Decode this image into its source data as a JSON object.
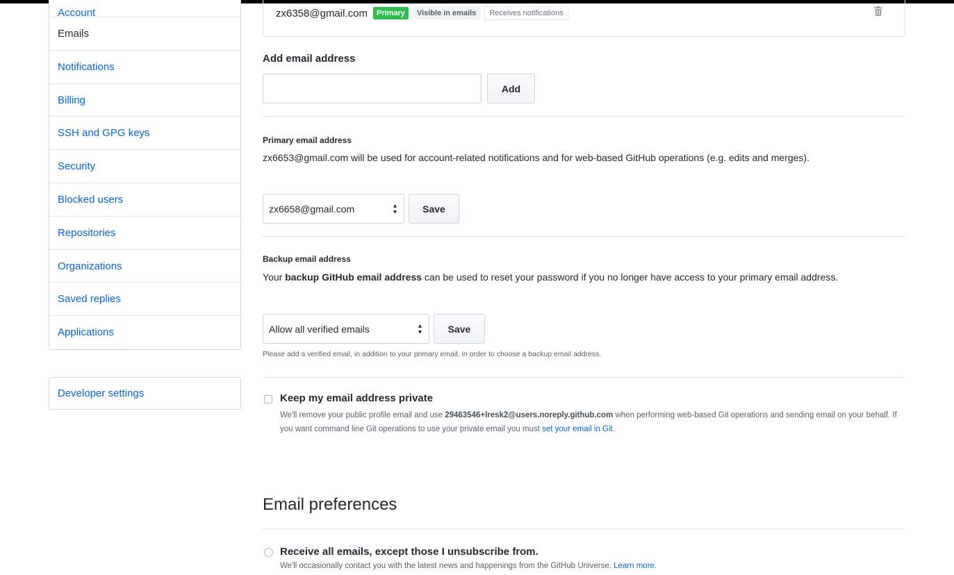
{
  "sidebar": {
    "items": [
      {
        "label": "Account"
      },
      {
        "label": "Emails"
      },
      {
        "label": "Notifications"
      },
      {
        "label": "Billing"
      },
      {
        "label": "SSH and GPG keys"
      },
      {
        "label": "Security"
      },
      {
        "label": "Blocked users"
      },
      {
        "label": "Repositories"
      },
      {
        "label": "Organizations"
      },
      {
        "label": "Saved replies"
      },
      {
        "label": "Applications"
      }
    ],
    "developer_settings": "Developer settings"
  },
  "email_entry": {
    "address": "zx6358@gmail.com",
    "badge_primary": "Primary",
    "badge_visible": "Visible in emails",
    "badge_notifications": "Receives notifications",
    "trash_icon": "trash-icon"
  },
  "add_email": {
    "heading": "Add email address",
    "input_value": "",
    "button": "Add"
  },
  "primary_email": {
    "heading": "Primary email address",
    "description": "zx6653@gmail.com will be used for account-related notifications and for web-based GitHub operations (e.g. edits and merges).",
    "select_value": "zx6658@gmail.com",
    "button": "Save"
  },
  "backup_email": {
    "heading": "Backup email address",
    "desc_prefix": "Your ",
    "desc_strong": "backup GitHub email address",
    "desc_suffix": " can be used to reset your password if you no longer have access to your primary email address.",
    "select_value": "Allow all verified emails",
    "button": "Save",
    "note": "Please add a verified email, in addition to your primary email, in order to choose a backup email address."
  },
  "keep_private": {
    "label": "Keep my email address private",
    "desc_prefix": "We'll remove your public profile email and use ",
    "noreply": "29463546+lresk2@users.noreply.github.com",
    "desc_middle": " when performing web-based Git operations and sending email on your behalf. If you want command line Git operations to use your private email you must ",
    "link": "set your email in Git",
    "desc_suffix": "."
  },
  "email_preferences": {
    "heading": "Email preferences",
    "option_label": "Receive all emails, except those I unsubscribe from.",
    "option_desc": "We'll occasionally contact you with the latest news and happenings from the GitHub Universe. ",
    "learn_more": "Learn more."
  },
  "colors": {
    "link": "#0366d6",
    "primary_badge": "#2cbe4e",
    "border": "#e1e4e8"
  }
}
